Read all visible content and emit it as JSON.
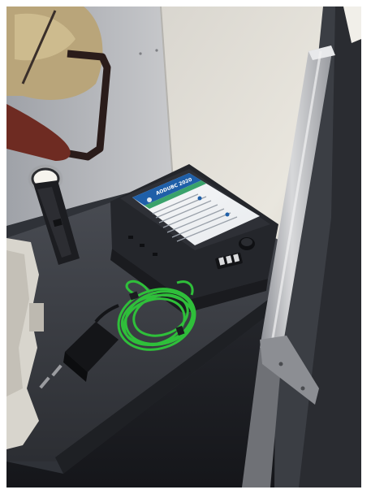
{
  "image": {
    "kind": "photograph",
    "device_screen": {
      "title": "AODUBC 2020",
      "accent": "#1f5fa8",
      "header_stripe": "#3aa26b"
    },
    "colors": {
      "wall_light": "#e6e2da",
      "shelf": "#3b3e45",
      "cable": "#2fbf3a",
      "device_body": "#26282d",
      "flashlight_beam": "#f4f1e8"
    }
  }
}
